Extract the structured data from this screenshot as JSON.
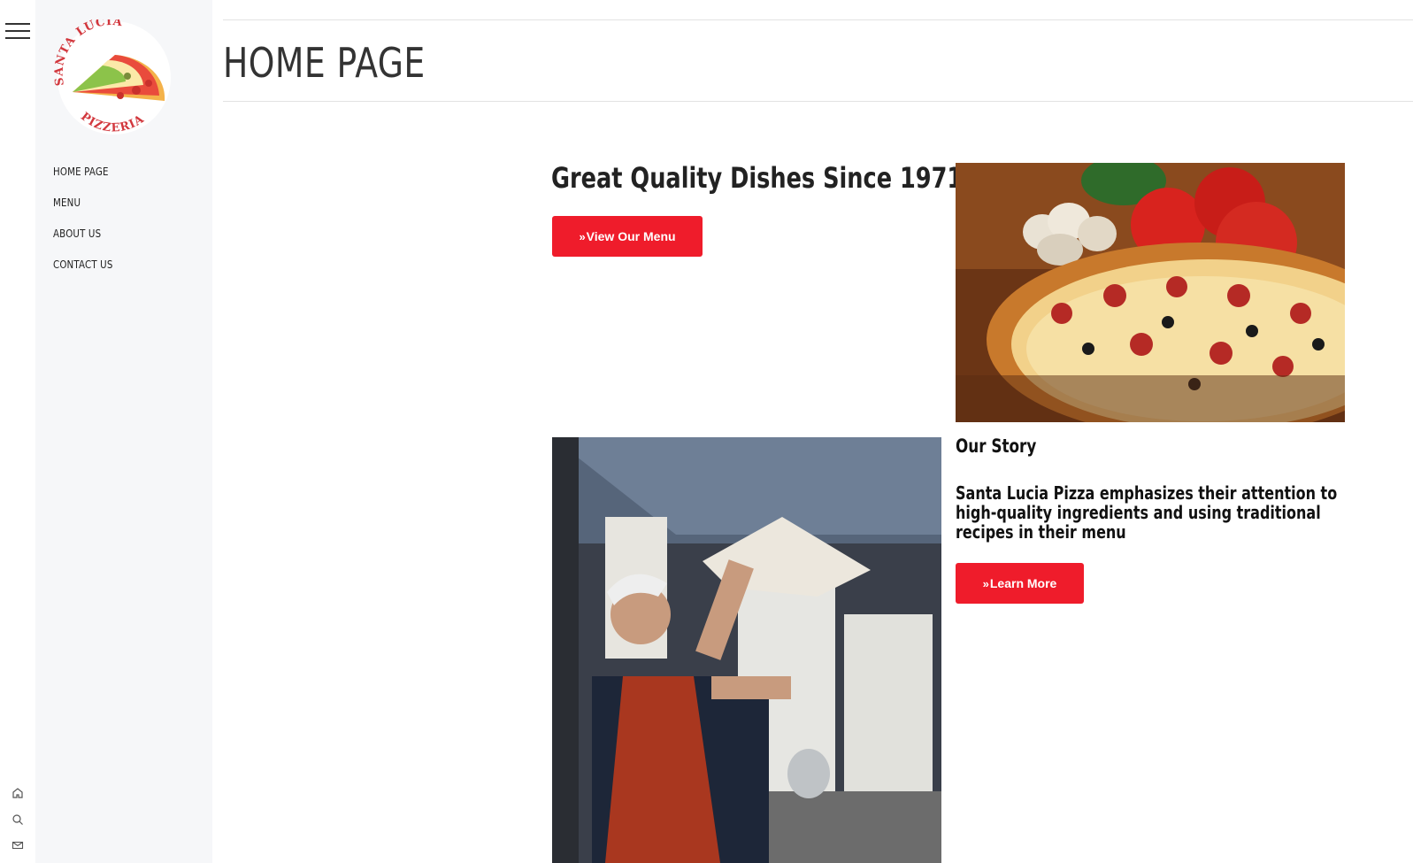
{
  "sidebar": {
    "logo": {
      "top_text": "SANTA LUCIA",
      "bottom_text": "PIZZERIA"
    },
    "nav": [
      {
        "label": "HOME PAGE"
      },
      {
        "label": "MENU"
      },
      {
        "label": "ABOUT US"
      },
      {
        "label": "CONTACT US"
      }
    ]
  },
  "rail": {
    "icons": [
      "menu-icon",
      "home-icon",
      "search-icon",
      "mail-icon"
    ]
  },
  "header": {
    "title": "HOME PAGE"
  },
  "hero": {
    "heading": "Great Quality Dishes Since 1971",
    "button_label": "View Our Menu",
    "button_icon": "double-chevron-right-icon"
  },
  "story": {
    "title": "Our Story",
    "text": "Santa Lucia Pizza emphasizes their attention to high-quality ingredients and using traditional recipes in their menu",
    "button_label": "Learn More"
  },
  "colors": {
    "accent": "#ef1c2b",
    "sidebar_bg": "#f6f7f9",
    "text": "#222222"
  }
}
